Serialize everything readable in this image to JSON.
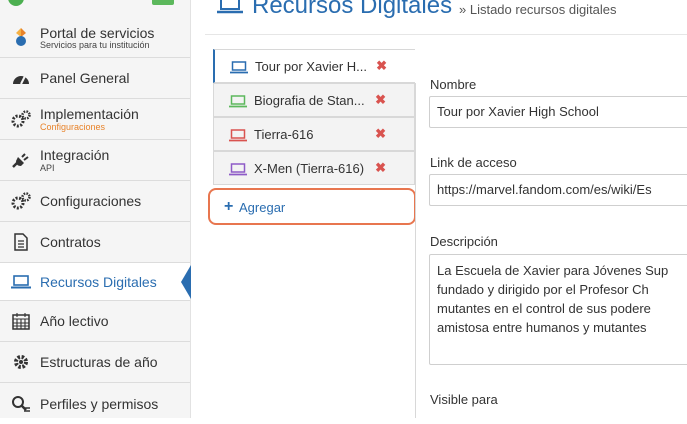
{
  "sidebar": {
    "items": [
      {
        "label": "Portal de servicios",
        "sub": "Servicios para tu institución",
        "icon": "portal-icon"
      },
      {
        "label": "Panel General",
        "sub": "",
        "icon": "dashboard-icon"
      },
      {
        "label": "Implementación",
        "sub": "Configuraciones",
        "icon": "gears-icon"
      },
      {
        "label": "Integración",
        "sub": "API",
        "icon": "plug-icon"
      },
      {
        "label": "Configuraciones",
        "sub": "",
        "icon": "gears-icon"
      },
      {
        "label": "Contratos",
        "sub": "",
        "icon": "document-icon"
      },
      {
        "label": "Recursos Digitales",
        "sub": "",
        "icon": "laptop-icon"
      },
      {
        "label": "Año lectivo",
        "sub": "",
        "icon": "calendar-icon"
      },
      {
        "label": "Estructuras de año",
        "sub": "",
        "icon": "gear-icon"
      },
      {
        "label": "Perfiles y permisos",
        "sub": "",
        "icon": "user-search-icon"
      }
    ],
    "active_index": 6
  },
  "header": {
    "title": "Recursos Digitales",
    "subtitle": "» Listado recursos digitales"
  },
  "tabs": [
    {
      "label": "Tour por Xavier H...",
      "icon_color": "#2a6db0"
    },
    {
      "label": "Biografia de Stan...",
      "icon_color": "#5cb85c"
    },
    {
      "label": "Tierra-616",
      "icon_color": "#d9534f"
    },
    {
      "label": "X-Men (Tierra-616)",
      "icon_color": "#8e5bc7"
    }
  ],
  "add_label": "Agregar",
  "form": {
    "nombre_label": "Nombre",
    "nombre_value": "Tour por Xavier High School",
    "link_label": "Link de acceso",
    "link_value": "https://marvel.fandom.com/es/wiki/Es",
    "descripcion_label": "Descripción",
    "descripcion_lines": [
      "La Escuela de Xavier para Jóvenes Sup",
      "fundado y dirigido por el Profesor Ch",
      "mutantes en el control de sus podere",
      "amistosa entre humanos y mutantes"
    ],
    "visible_label": "Visible para"
  }
}
